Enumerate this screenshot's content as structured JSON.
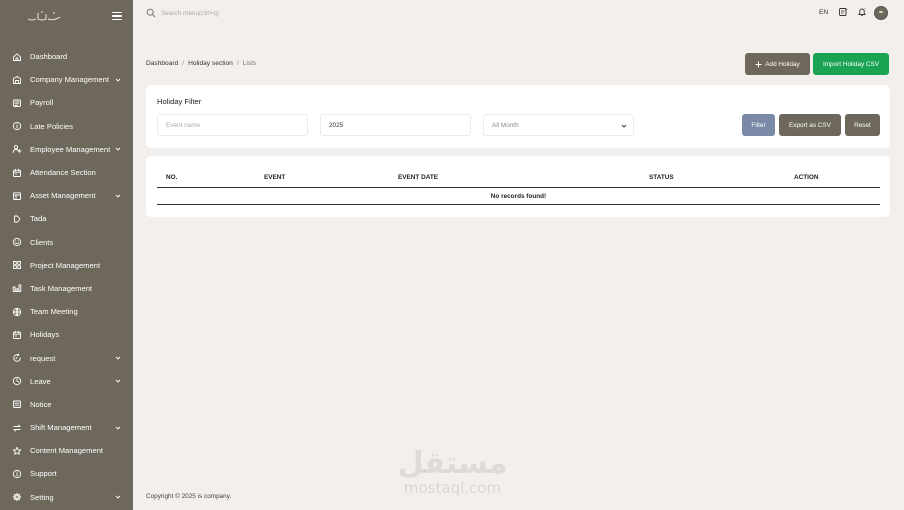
{
  "sidebar": {
    "logo_alt": "logo",
    "items": [
      {
        "label": "Dashboard",
        "icon": "home-icon",
        "has_children": false
      },
      {
        "label": "Company Management",
        "icon": "building-icon",
        "has_children": true
      },
      {
        "label": "Payroll",
        "icon": "payroll-icon",
        "has_children": false
      },
      {
        "label": "Late Policies",
        "icon": "info-icon",
        "has_children": false
      },
      {
        "label": "Employee Management",
        "icon": "user-add-icon",
        "has_children": true
      },
      {
        "label": "Attendance Section",
        "icon": "calendar-icon",
        "has_children": false
      },
      {
        "label": "Asset Management",
        "icon": "table-icon",
        "has_children": true
      },
      {
        "label": "Tada",
        "icon": "tag-icon",
        "has_children": false
      },
      {
        "label": "Clients",
        "icon": "smile-icon",
        "has_children": false
      },
      {
        "label": "Project Management",
        "icon": "grid-icon",
        "has_children": false
      },
      {
        "label": "Task Management",
        "icon": "chart-icon",
        "has_children": false
      },
      {
        "label": "Team Meeting",
        "icon": "globe-icon",
        "has_children": false
      },
      {
        "label": "Holidays",
        "icon": "calendar-icon",
        "has_children": false
      },
      {
        "label": "request",
        "icon": "refresh-icon",
        "has_children": true
      },
      {
        "label": "Leave",
        "icon": "clock-icon",
        "has_children": true
      },
      {
        "label": "Notice",
        "icon": "notice-icon",
        "has_children": false
      },
      {
        "label": "Shift Management",
        "icon": "swap-icon",
        "has_children": true
      },
      {
        "label": "Content Management",
        "icon": "star-icon",
        "has_children": false
      },
      {
        "label": "Support",
        "icon": "support-icon",
        "has_children": false
      },
      {
        "label": "Setting",
        "icon": "gear-icon",
        "has_children": true
      }
    ]
  },
  "topbar": {
    "search_placeholder": "Search menu(ctrl+q)",
    "language": "EN"
  },
  "breadcrumb": {
    "items": [
      "Dashboard",
      "Holiday section",
      "Lists"
    ],
    "separator": "/"
  },
  "actions": {
    "add_label": "Add Holiday",
    "import_label": "Import Holiday CSV"
  },
  "filter": {
    "title": "Holiday Filter",
    "event_placeholder": "Event name",
    "year_value": "2025",
    "month_value": "All Month",
    "filter_label": "Filter",
    "export_label": "Export as CSV",
    "reset_label": "Reset"
  },
  "table": {
    "columns": [
      "NO.",
      "EVENT",
      "EVENT DATE",
      "STATUS",
      "ACTION"
    ],
    "empty_message": "No records found!"
  },
  "footer": {
    "text": "Copyright © 2025 is company."
  },
  "watermark": {
    "arabic": "مستقل",
    "latin": "mostaql.com"
  },
  "colors": {
    "sidebar_bg": "#6d685b",
    "page_bg": "#f3efec",
    "import_green": "#1aa352",
    "filter_blue": "#7a8aa6"
  }
}
